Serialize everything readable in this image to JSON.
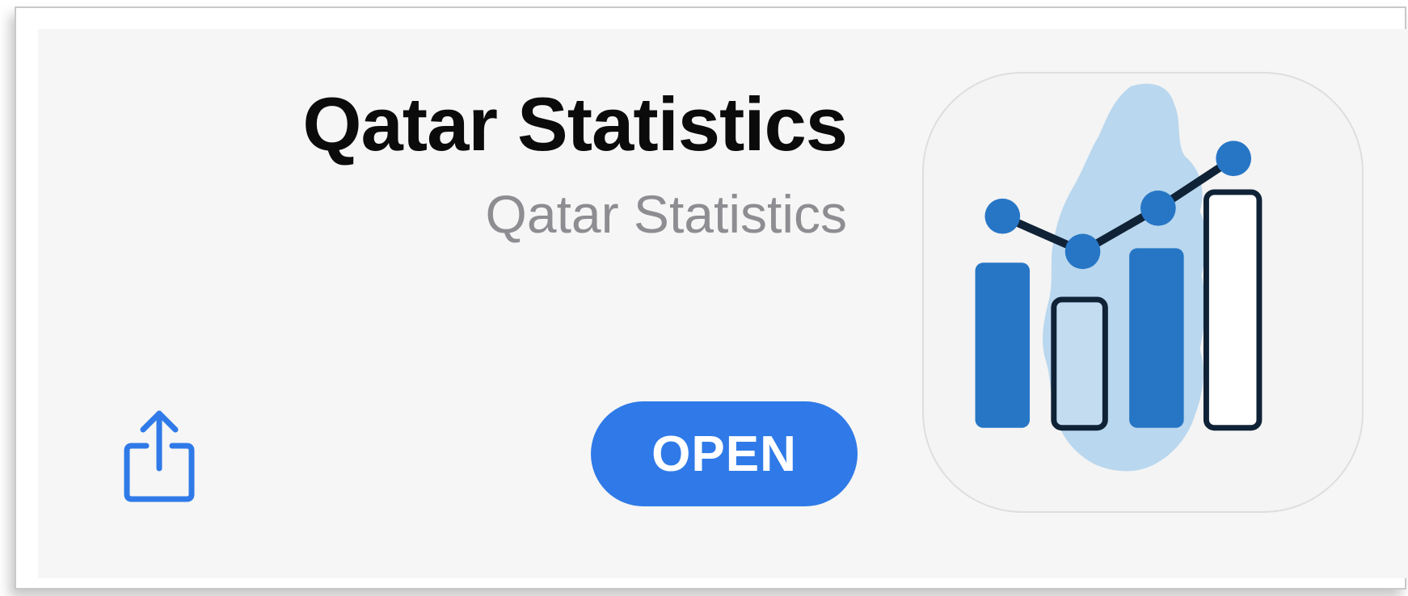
{
  "app": {
    "name": "Qatar Statistics",
    "developer": "Qatar Statistics"
  },
  "actions": {
    "open_label": "OPEN",
    "share_icon": "share-icon"
  },
  "icon": {
    "name": "app-icon",
    "primary_color": "#2776c6",
    "map_color": "#b9d7ee",
    "outline_color": "#0f2236"
  },
  "colors": {
    "accent": "#2f7ae8",
    "title": "#0b0b0b",
    "subtitle": "#8d8d92",
    "card_background": "#f6f6f6"
  }
}
